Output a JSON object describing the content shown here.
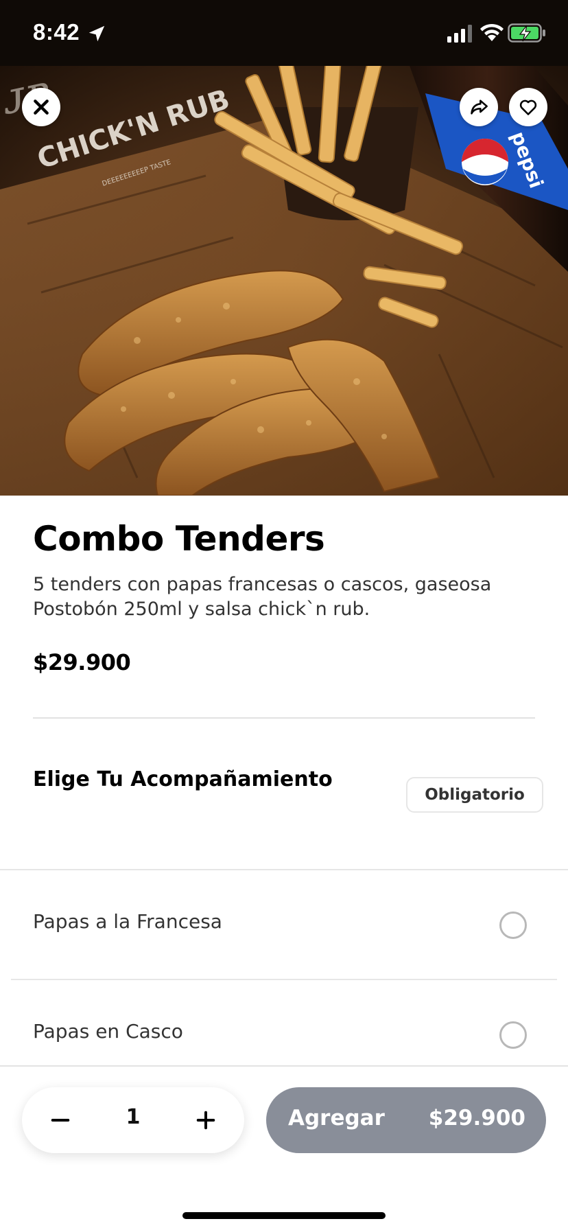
{
  "status_bar": {
    "time": "8:42",
    "icons": [
      "location-arrow-icon",
      "signal-icon",
      "wifi-icon",
      "battery-charging-icon"
    ]
  },
  "hero": {
    "logo_text": "CHICK'N RUB",
    "logo_subtext": "DEEEEEEEEEP TASTE",
    "bottle_brand": "pepsi",
    "actions": [
      "close-icon",
      "share-icon",
      "heart-icon"
    ]
  },
  "product": {
    "title": "Combo Tenders",
    "description": "5 tenders con papas francesas o cascos, gaseosa Postobón 250ml y salsa chick`n rub.",
    "price": "$29.900"
  },
  "options_section": {
    "title": "Elige Tu Acompañamiento",
    "badge": "Obligatorio",
    "options": [
      {
        "label": "Papas a la Francesa",
        "selected": false
      },
      {
        "label": "Papas en Casco",
        "selected": false
      }
    ]
  },
  "footer": {
    "quantity": "1",
    "add_label": "Agregar",
    "add_price": "$29.900",
    "add_button_color": "#898e99"
  }
}
